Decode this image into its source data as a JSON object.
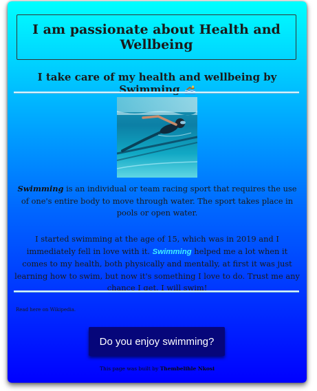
{
  "header": {
    "title": "I am passionate about Health and Wellbeing",
    "subtitle": "I take care of my health and wellbeing by Swimming",
    "subtitle_icon": "swimmer-emoji"
  },
  "main": {
    "paragraph1": {
      "highlight": "Swimming",
      "text": " is an individual or team racing sport that requires the use of one's entire body to move through water. The sport takes place in pools or open water."
    },
    "paragraph2": {
      "before": "I started swimming at the age of 15, which was in 2019 and I immediately fell in love with it. ",
      "highlight": "Swimming",
      "after": " helped me a lot when it comes to my health, both physically and mentally, at first it was just learning how to swim, but now it's something I love to do. Trust me any chance I get, I will swim!"
    },
    "wiki_link": "Read here on Wikipedia.",
    "cta_label": "Do you enjoy swimming?"
  },
  "footer": {
    "prefix": "This page was built by ",
    "author": "Thembelihle Nkosi"
  },
  "colors": {
    "gradient_top": "#00ffff",
    "gradient_bottom": "#0000ff",
    "button_bg": "#06067a",
    "highlight_text": "#3ff0ff"
  }
}
